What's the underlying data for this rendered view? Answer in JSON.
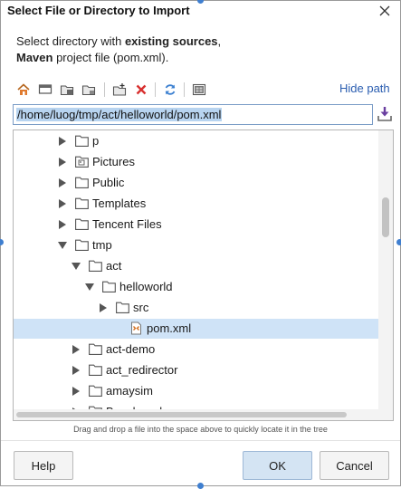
{
  "window": {
    "title": "Select File or Directory to Import"
  },
  "description": {
    "line1_prefix": "Select directory with ",
    "line1_bold": "existing sources",
    "line1_suffix": ",",
    "line2_bold": "Maven",
    "line2_suffix": " project file (pom.xml)."
  },
  "toolbar": {
    "icons": [
      "home-icon",
      "desktop-icon",
      "project-folder-icon",
      "module-folder-icon",
      "new-folder-icon",
      "delete-icon",
      "refresh-icon",
      "show-hidden-icon"
    ],
    "hide_path_label": "Hide path"
  },
  "path": {
    "value": "/home/luog/tmp/act/helloworld/pom.xml"
  },
  "tree": {
    "rows": [
      {
        "label": "p",
        "depth": 2,
        "expanded": false,
        "type": "folder",
        "selected": false
      },
      {
        "label": "Pictures",
        "depth": 2,
        "expanded": false,
        "type": "folder-special",
        "selected": false
      },
      {
        "label": "Public",
        "depth": 2,
        "expanded": false,
        "type": "folder",
        "selected": false
      },
      {
        "label": "Templates",
        "depth": 2,
        "expanded": false,
        "type": "folder",
        "selected": false
      },
      {
        "label": "Tencent Files",
        "depth": 2,
        "expanded": false,
        "type": "folder",
        "selected": false
      },
      {
        "label": "tmp",
        "depth": 2,
        "expanded": true,
        "type": "folder",
        "selected": false
      },
      {
        "label": "act",
        "depth": 3,
        "expanded": true,
        "type": "folder",
        "selected": false
      },
      {
        "label": "helloworld",
        "depth": 4,
        "expanded": true,
        "type": "folder",
        "selected": false
      },
      {
        "label": "src",
        "depth": 5,
        "expanded": false,
        "type": "folder",
        "selected": false
      },
      {
        "label": "pom.xml",
        "depth": 6,
        "expanded": null,
        "type": "maven-file",
        "selected": true
      },
      {
        "label": "act-demo",
        "depth": 3,
        "expanded": false,
        "type": "folder",
        "selected": false
      },
      {
        "label": "act_redirector",
        "depth": 3,
        "expanded": false,
        "type": "folder",
        "selected": false
      },
      {
        "label": "amaysim",
        "depth": 3,
        "expanded": false,
        "type": "folder",
        "selected": false
      },
      {
        "label": "Benchmark",
        "depth": 3,
        "expanded": false,
        "type": "folder",
        "selected": false
      }
    ]
  },
  "hint": "Drag and drop a file into the space above to quickly locate it in the tree",
  "buttons": {
    "help": "Help",
    "ok": "OK",
    "cancel": "Cancel"
  },
  "colors": {
    "selection": "#cfe3f7",
    "accent": "#2a5db0",
    "folder": "#d9a13a"
  }
}
